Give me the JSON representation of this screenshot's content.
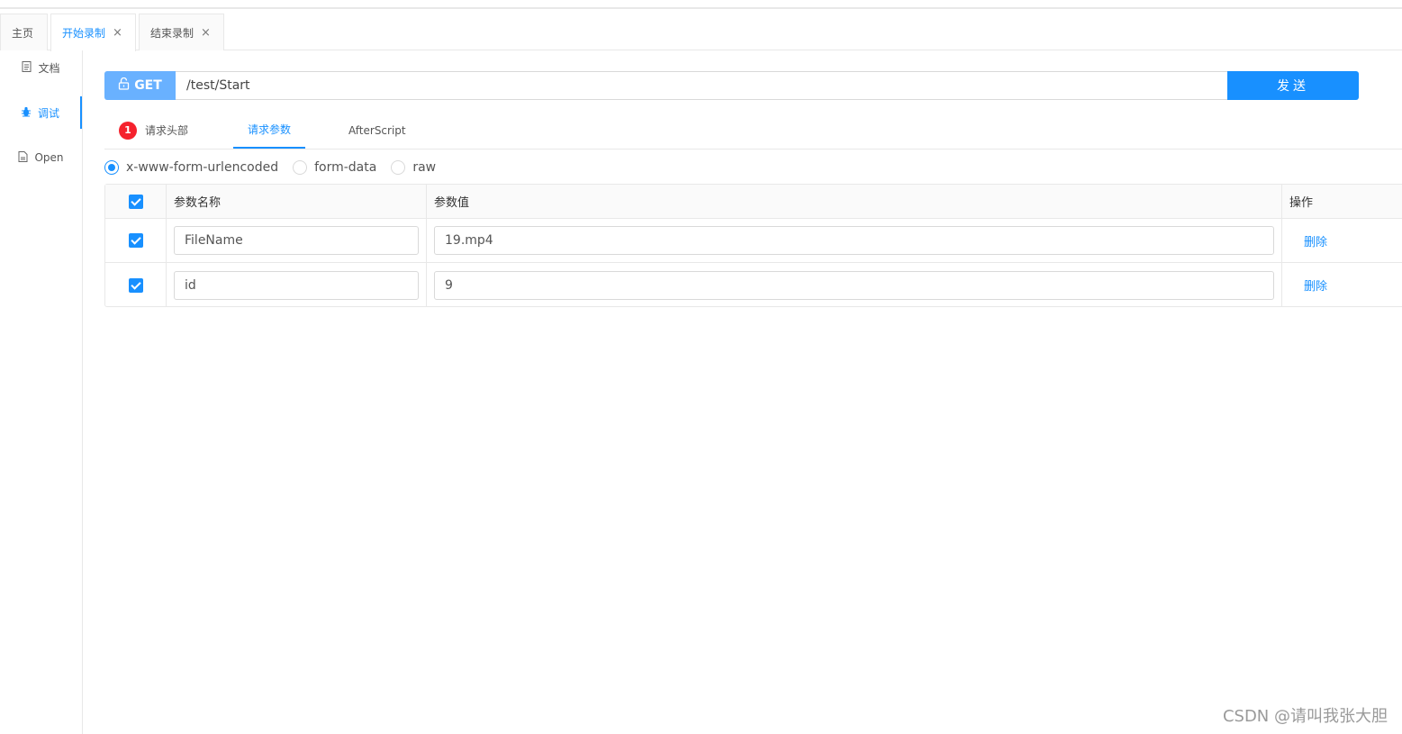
{
  "tabs": [
    {
      "label": "主页",
      "closable": false
    },
    {
      "label": "开始录制",
      "closable": true,
      "active": true
    },
    {
      "label": "结束录制",
      "closable": true
    }
  ],
  "tab_close_glyph": "×",
  "sidebar": {
    "items": [
      {
        "label": "文档",
        "icon": "document-icon"
      },
      {
        "label": "调试",
        "icon": "bug-icon",
        "active": true
      },
      {
        "label": "Open",
        "icon": "file-icon"
      }
    ]
  },
  "request": {
    "method": "GET",
    "url": "/test/Start",
    "send_label": "发送"
  },
  "subtabs": {
    "headers_badge": "1",
    "headers_label": "请求头部",
    "params_label": "请求参数",
    "afterscript_label": "AfterScript"
  },
  "body_types": {
    "options": [
      "x-www-form-urlencoded",
      "form-data",
      "raw"
    ],
    "selected": "x-www-form-urlencoded"
  },
  "params_table": {
    "headers": {
      "name": "参数名称",
      "value": "参数值",
      "action": "操作"
    },
    "rows": [
      {
        "checked": true,
        "name": "FileName",
        "value": "19.mp4",
        "action": "删除"
      },
      {
        "checked": true,
        "name": "id",
        "value": "9",
        "action": "删除"
      }
    ]
  },
  "watermark": "CSDN @请叫我张大胆",
  "colors": {
    "accent": "#1890ff",
    "method_bg": "#69b1ff",
    "badge": "#f5222d"
  }
}
